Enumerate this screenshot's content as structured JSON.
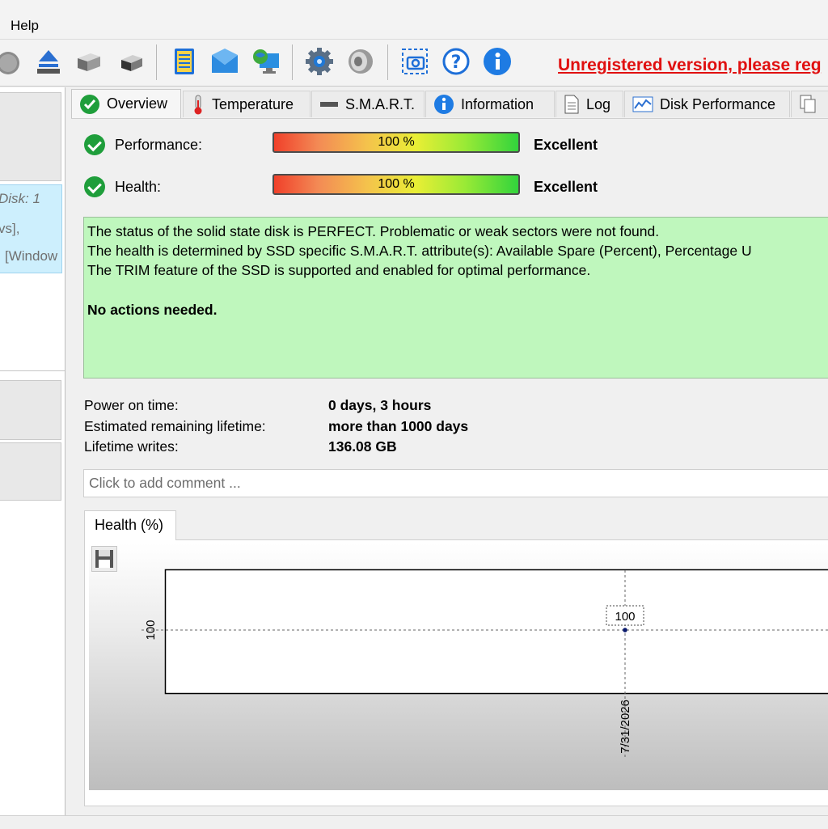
{
  "menu": {
    "help_label": "Help"
  },
  "toolbar": {
    "icons": [
      "disk-icon",
      "eject-icon",
      "hdd-icon",
      "hdd-small-icon",
      "notepad-icon",
      "mail-icon",
      "globe-monitor-icon",
      "gear-icon",
      "speaker-icon",
      "camera-icon",
      "help-icon",
      "info-icon"
    ],
    "unregistered_text": "Unregistered version, please reg"
  },
  "left_panel": {
    "disk_line1": "Disk: 1",
    "disk_line2": "vs],",
    "disk_line3": "[Window"
  },
  "tabs": [
    {
      "label": "Overview",
      "icon": "check-icon"
    },
    {
      "label": "Temperature",
      "icon": "thermometer-icon"
    },
    {
      "label": "S.M.A.R.T.",
      "icon": "smart-icon"
    },
    {
      "label": "Information",
      "icon": "info-icon"
    },
    {
      "label": "Log",
      "icon": "document-icon"
    },
    {
      "label": "Disk Performance",
      "icon": "chart-icon"
    }
  ],
  "performance": {
    "label": "Performance:",
    "value_text": "100 %",
    "value": 100,
    "rating": "Excellent"
  },
  "health": {
    "label": "Health:",
    "value_text": "100 %",
    "value": 100,
    "rating": "Excellent"
  },
  "status": {
    "line1": "The status of the solid state disk is PERFECT. Problematic or weak sectors were not found.",
    "line2": "The health is determined by SSD specific S.M.A.R.T. attribute(s):  Available Spare (Percent), Percentage U",
    "line3": "The TRIM feature of the SSD is supported and enabled for optimal performance.",
    "action": "No actions needed.",
    "background": "#bff7bd"
  },
  "info": {
    "power_on_label": "Power on time:",
    "power_on_value": "0 days, 3 hours",
    "remaining_label": "Estimated remaining lifetime:",
    "remaining_value": "more than 1000 days",
    "writes_label": "Lifetime writes:",
    "writes_value": "136.08 GB"
  },
  "comment": {
    "placeholder": "Click to add comment ..."
  },
  "chart_tab": {
    "label": "Health (%)"
  },
  "chart_data": {
    "type": "line",
    "x": [
      "7/31/2026"
    ],
    "y": [
      100
    ],
    "point_labels": [
      "100"
    ],
    "ytick_labels": [
      "100"
    ],
    "xtick_labels": [
      "7/31/2026"
    ],
    "title": "Health (%)",
    "grid": "dashed crosshair"
  },
  "colors": {
    "unregistered": "#e01010",
    "check": "#1f9e3b"
  }
}
